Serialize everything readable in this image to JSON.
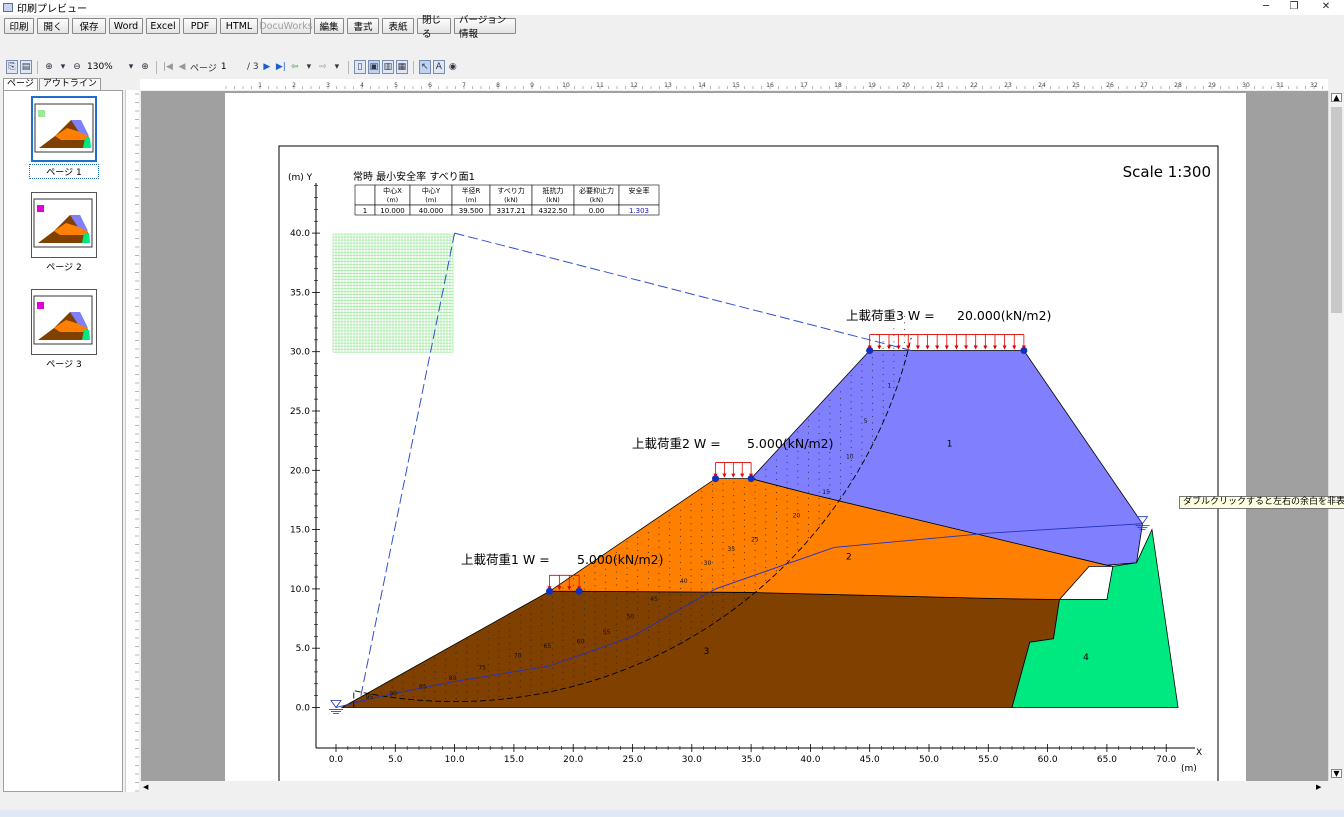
{
  "window": {
    "title": "印刷プレビュー",
    "minimize": "─",
    "restore": "❐",
    "close": "✕"
  },
  "menu": {
    "buttons": [
      {
        "label": "印刷",
        "name": "print-button"
      },
      {
        "label": "開く",
        "name": "open-button"
      },
      {
        "label": "保存",
        "name": "save-button"
      },
      {
        "label": "Word",
        "name": "word-button"
      },
      {
        "label": "Excel",
        "name": "excel-button"
      },
      {
        "label": "PDF",
        "name": "pdf-button"
      },
      {
        "label": "HTML",
        "name": "html-button"
      },
      {
        "label": "DocuWorks",
        "name": "docuworks-button"
      },
      {
        "label": "編集",
        "name": "edit-button"
      },
      {
        "label": "書式",
        "name": "format-button"
      },
      {
        "label": "表紙",
        "name": "cover-button"
      },
      {
        "label": "閉じる",
        "name": "close-button"
      },
      {
        "label": "バージョン情報",
        "name": "version-info-button"
      }
    ]
  },
  "toolbar": {
    "zoom": "130%",
    "page_label": "ページ",
    "page_current": "1",
    "page_total": "/ 3"
  },
  "left_panel": {
    "tabs": [
      "ページ",
      "アウトライン"
    ],
    "pages": [
      {
        "label": "ページ 1",
        "selected": true
      },
      {
        "label": "ページ 2",
        "selected": false
      },
      {
        "label": "ページ 3",
        "selected": false
      }
    ]
  },
  "tooltip": "ダブルクリックすると左右の余白を非表示にします",
  "drawing": {
    "scale": "Scale 1:300",
    "title": "常時 最小安全率 すべり面1",
    "y_axis_label": "(m) Y",
    "x_axis_label": "X",
    "x_unit": "(m)",
    "table": {
      "headers": [
        [
          "",
          ""
        ],
        [
          "中心X",
          "(m)"
        ],
        [
          "中心Y",
          "(m)"
        ],
        [
          "半径R",
          "(m)"
        ],
        [
          "すべり力",
          "(kN)"
        ],
        [
          "抵抗力",
          "(kN)"
        ],
        [
          "必要抑止力",
          "(kN)"
        ],
        [
          "安全率",
          ""
        ]
      ],
      "row": [
        "1",
        "10.000",
        "40.000",
        "39.500",
        "3317.21",
        "4322.50",
        "0.00",
        "1.303"
      ]
    },
    "x_ticks": [
      "0.0",
      "5.0",
      "10.0",
      "15.0",
      "20.0",
      "25.0",
      "30.0",
      "35.0",
      "40.0",
      "45.0",
      "50.0",
      "55.0",
      "60.0",
      "65.0",
      "70.0"
    ],
    "y_ticks": [
      "0.0",
      "5.0",
      "10.0",
      "15.0",
      "20.0",
      "25.0",
      "30.0",
      "35.0",
      "40.0"
    ],
    "loads": [
      {
        "label": "上載荷重1  W =",
        "value": "5.000(kN/m2)"
      },
      {
        "label": "上載荷重2  W =",
        "value": "5.000(kN/m2)"
      },
      {
        "label": "上載荷重3  W =",
        "value": "20.000(kN/m2)"
      }
    ],
    "layers": [
      {
        "id": "1",
        "color": "#8080ff"
      },
      {
        "id": "2",
        "color": "#ff8000"
      },
      {
        "id": "3",
        "color": "#804000"
      },
      {
        "id": "4",
        "color": "#00e880"
      }
    ],
    "slice_labels": [
      "5",
      "10",
      "15",
      "20",
      "25",
      "30",
      "35",
      "40",
      "45",
      "50",
      "55",
      "60",
      "65",
      "70",
      "75",
      "80",
      "85",
      "90",
      "95",
      "1"
    ]
  }
}
